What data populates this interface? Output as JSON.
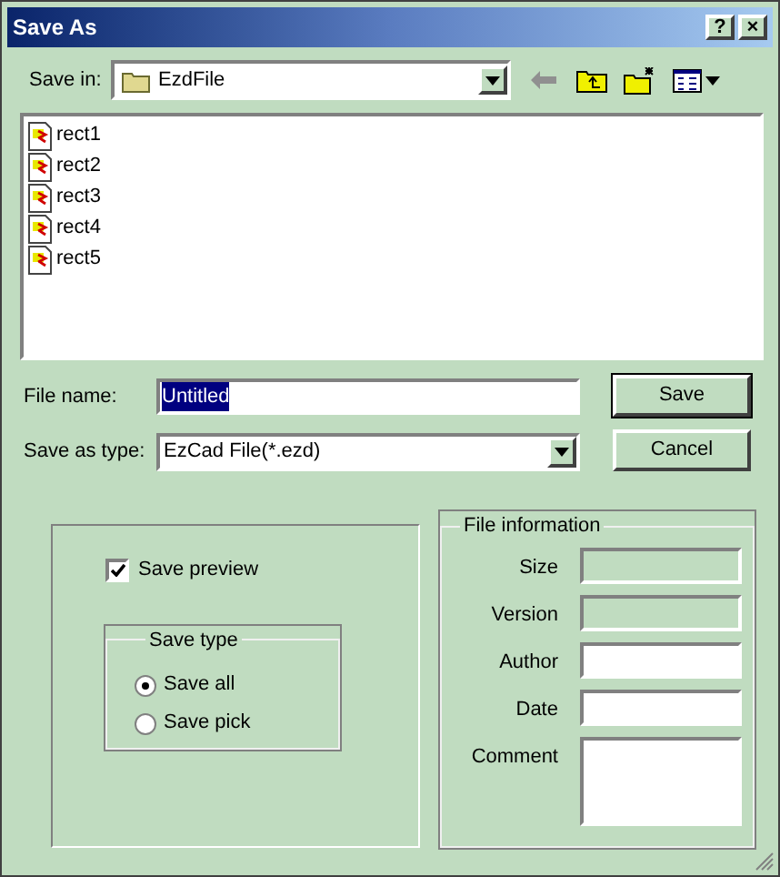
{
  "window": {
    "title": "Save As",
    "buttons": [
      "?",
      "×"
    ]
  },
  "save_in": {
    "label": "Save in:",
    "value": "EzdFile"
  },
  "files": [
    {
      "name": "rect1",
      "selected": false
    },
    {
      "name": "rect2",
      "selected": false
    },
    {
      "name": "rect3",
      "selected": false
    },
    {
      "name": "rect4",
      "selected": false
    },
    {
      "name": "rect5",
      "selected": false
    }
  ],
  "file_name": {
    "label": "File name:",
    "value": "Untitled",
    "highlighted": true
  },
  "save_as_type": {
    "label": "Save as type:",
    "value": "EzCad File(*.ezd)"
  },
  "buttons": [
    "Save",
    "Cancel"
  ],
  "save_preview": {
    "label": "Save preview",
    "checked": true
  },
  "save_type": {
    "title": "Save type",
    "options": [
      {
        "label": "Save all",
        "selected": true
      },
      {
        "label": "Save pick",
        "selected": false
      }
    ]
  },
  "file_information": {
    "title": "File information",
    "fields": [
      {
        "label": "Size",
        "disabled": true,
        "kind": "line"
      },
      {
        "label": "Version",
        "disabled": true,
        "kind": "line"
      },
      {
        "label": "Author",
        "disabled": false,
        "kind": "line"
      },
      {
        "label": "Date",
        "disabled": false,
        "kind": "line"
      },
      {
        "label": "Comment",
        "disabled": false,
        "kind": "area"
      }
    ]
  }
}
